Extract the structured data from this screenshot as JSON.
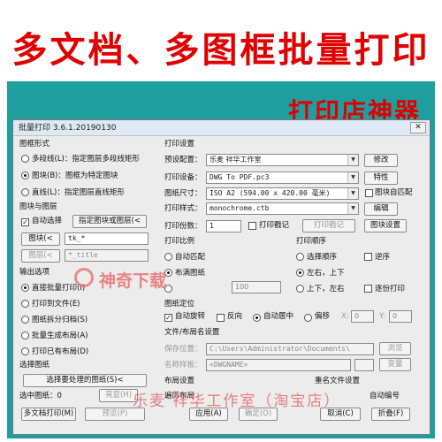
{
  "banner": {
    "title": "多文档、多图框批量打印",
    "subtitle": "打印店神器"
  },
  "dialog": {
    "title": "批量打印 3.6.1.20190130"
  },
  "frame_format": {
    "heading": "图框形式",
    "options": [
      "多段线(L)：指定图层多段线矩形",
      "图块(B)：图框为特定图块",
      "直线(L)：指定图层直线矩形"
    ]
  },
  "block_layer": {
    "heading": "图块与图层",
    "auto_select": "自动选择",
    "select_button": "指定图块或图层(<",
    "block_label": "图块(<",
    "block_value": "tk_*",
    "layer_label": "图层(<",
    "layer_value": "*_title"
  },
  "output": {
    "heading": "输出选项",
    "options": [
      "直接批量打印(I)",
      "打印到文件(E)",
      "图纸拆分归档(S)",
      "批量生成布局(A)",
      "打印已有布局(D)"
    ]
  },
  "select_drawing": {
    "heading": "选择图纸",
    "button": "选择要处理的图纸(S)<",
    "selected_count": "选中图纸：0",
    "highlight": "亮显(H)"
  },
  "print_settings": {
    "heading": "打印设置",
    "preset_label": "预设配置：",
    "preset_value": "乐麦 祥华工作室",
    "modify": "修改",
    "printer_label": "打印设备：",
    "printer_value": "DWG To PDF.pc3",
    "properties": "特性",
    "paper_label": "图纸尺寸：",
    "paper_value": "ISO A2 (594.00 x 420.00 毫米)",
    "auto_match": "图块自匹配",
    "style_label": "打印样式：",
    "style_value": "monochrome.ctb",
    "edit": "编辑",
    "copies_label": "打印份数：",
    "copies_value": "1",
    "stamp": "打印戳记",
    "stamp_settings": "打印戳记",
    "sheet_settings": "图块设置"
  },
  "scale": {
    "heading": "打印比例",
    "options": [
      "自动匹配",
      "布满图纸"
    ],
    "value": "100"
  },
  "order": {
    "heading": "打印顺序",
    "options": [
      "选择顺序",
      "左右，上下",
      "上下，左右"
    ],
    "reverse": "逆序",
    "page_by_page": "逐份打印"
  },
  "positioning": {
    "heading": "图纸定位",
    "auto_rotate": "自动旋转",
    "reverse": "反向",
    "auto_center": "自动居中",
    "offset": "偏移",
    "x_label": "X:",
    "x_value": "0",
    "y_label": "Y:",
    "y_value": "0"
  },
  "file_layout": {
    "heading": "文件/布局名设置",
    "location_label": "保存位置：",
    "location_value": "C:\\Users\\Administrator\\Documents\\",
    "browse": "浏览",
    "prefix_label": "名称样板：",
    "prefix_value": "<DWGNAME>",
    "variables": "变量"
  },
  "layout_settings": {
    "heading": "布局设置",
    "traverse": "遍历布局"
  },
  "rename": {
    "heading": "重名文件设置",
    "auto": "自动编号"
  },
  "footer": {
    "multi_doc_print": "多文档打印(M)",
    "preview": "预览(P)",
    "apply": "应用(A)",
    "confirm": "确定(O)",
    "cancel": "取消(C)",
    "collapse": "折叠(F)"
  },
  "watermark": {
    "logo": "神奇下载",
    "footer": "乐麦 祥华工作室（淘宝店）"
  }
}
